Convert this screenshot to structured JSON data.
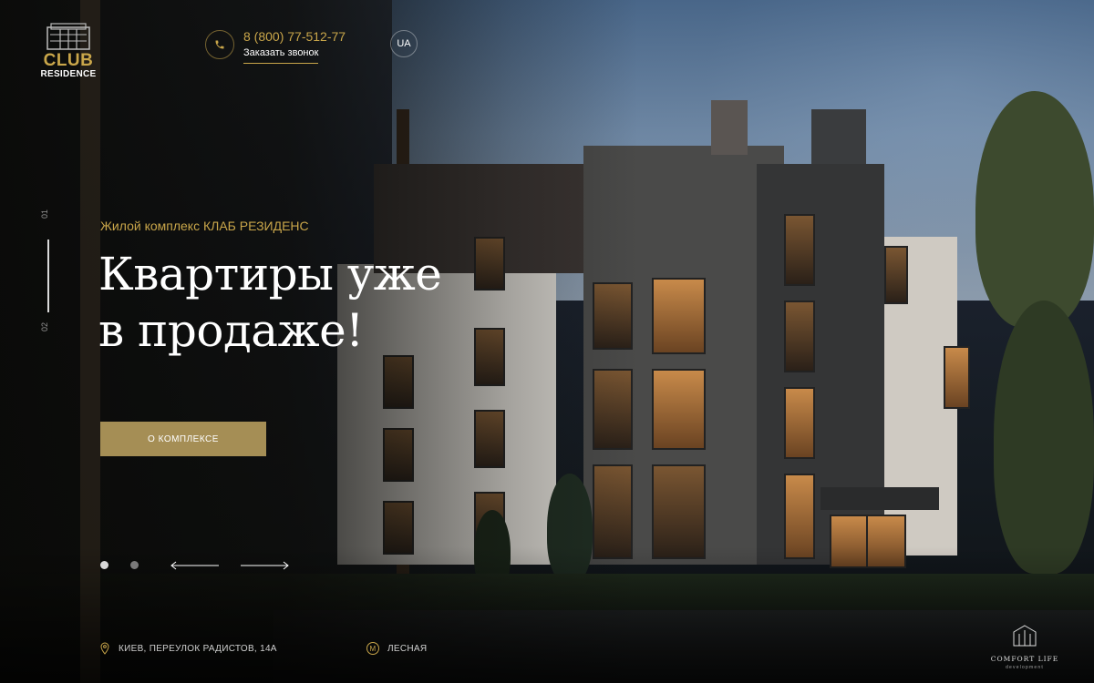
{
  "brand": {
    "logo_line1": "CLUB",
    "logo_line2": "RESIDENCE",
    "accent_color": "#c9a64a"
  },
  "header": {
    "phone": "8 (800) 77-512-77",
    "callback_label": "Заказать звонок",
    "language": "UA",
    "icons": [
      "phone-icon"
    ]
  },
  "slider": {
    "current_index": "01",
    "next_index": "02",
    "subtitle": "Жилой комплекс КЛАБ РЕЗИДЕНС",
    "headline_line1": "Квартиры уже",
    "headline_line2": "в продаже!",
    "cta_label": "О КОМПЛЕКСЕ",
    "dots_count": 2,
    "active_dot": 1
  },
  "footer": {
    "address": "КИЕВ, ПЕРЕУЛОК РАДИСТОВ, 14А",
    "metro_letter": "М",
    "metro": "ЛЕСНАЯ",
    "developer_name": "COMFORT LIFE",
    "developer_tagline": "development"
  }
}
